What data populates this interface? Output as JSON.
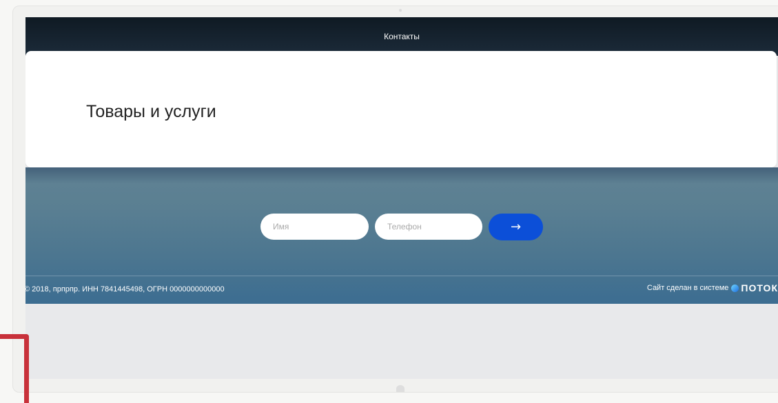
{
  "nav": {
    "contacts_label": "Контакты"
  },
  "card": {
    "title": "Товары и услуги"
  },
  "form": {
    "name_placeholder": "Имя",
    "phone_placeholder": "Телефон",
    "submit_label": "→"
  },
  "footer": {
    "copyright": "© 2018, прпрпр. ИНН 7841445498, ОГРН 0000000000000",
    "made_by_text": "Сайт сделан в системе",
    "brand": "ПОТОК"
  },
  "colors": {
    "nav_bg": "#13202b",
    "submit_bg": "#0c4fd8",
    "marker_red": "#c8313a"
  },
  "icons": {
    "submit": "arrow-right-icon",
    "brand": "potok-logo-icon"
  }
}
